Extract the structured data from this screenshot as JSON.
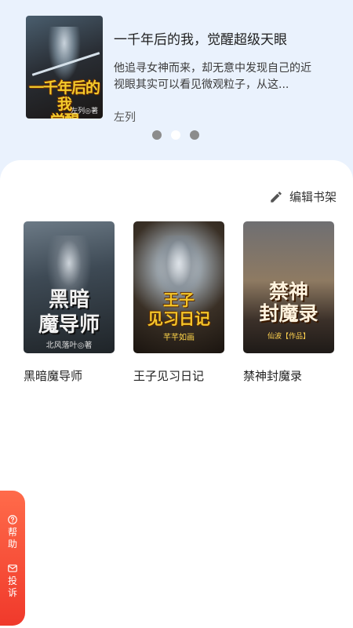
{
  "featured": {
    "title": "一千年后的我，觉醒超级天眼",
    "description": "他追寻女神而来，却无意中发现自己的近视眼其实可以看见微观粒子，从这...",
    "author": "左列",
    "cover_title": "一千年后的我\n觉醒\n超级天眼",
    "cover_author": "左列◎著",
    "cover_icon": "book-cover-image"
  },
  "carousel": {
    "total": 3,
    "active_index": 1
  },
  "shelf": {
    "edit_label": "编辑书架",
    "edit_icon": "pencil-icon",
    "books": [
      {
        "title": "黑暗魔导师",
        "cover_title": "黑暗\n魔导师",
        "cover_sub": "北风落叶◎著"
      },
      {
        "title": "王子见习日记",
        "cover_title": "王子\n见习日记",
        "cover_sub": "芊芊如画"
      },
      {
        "title": "禁神封魔录",
        "cover_title": "禁神\n封魔录",
        "cover_sub": "仙波【作品】"
      }
    ]
  },
  "side_tab": {
    "help_label": "帮助",
    "help_icon": "help-circle-icon",
    "complaint_label": "投诉",
    "complaint_icon": "mail-icon"
  },
  "colors": {
    "banner_bg": "#eaf2fd",
    "side_tab": "#f0392b",
    "dot_inactive": "#8c8c8c",
    "dot_active": "#ffffff"
  }
}
